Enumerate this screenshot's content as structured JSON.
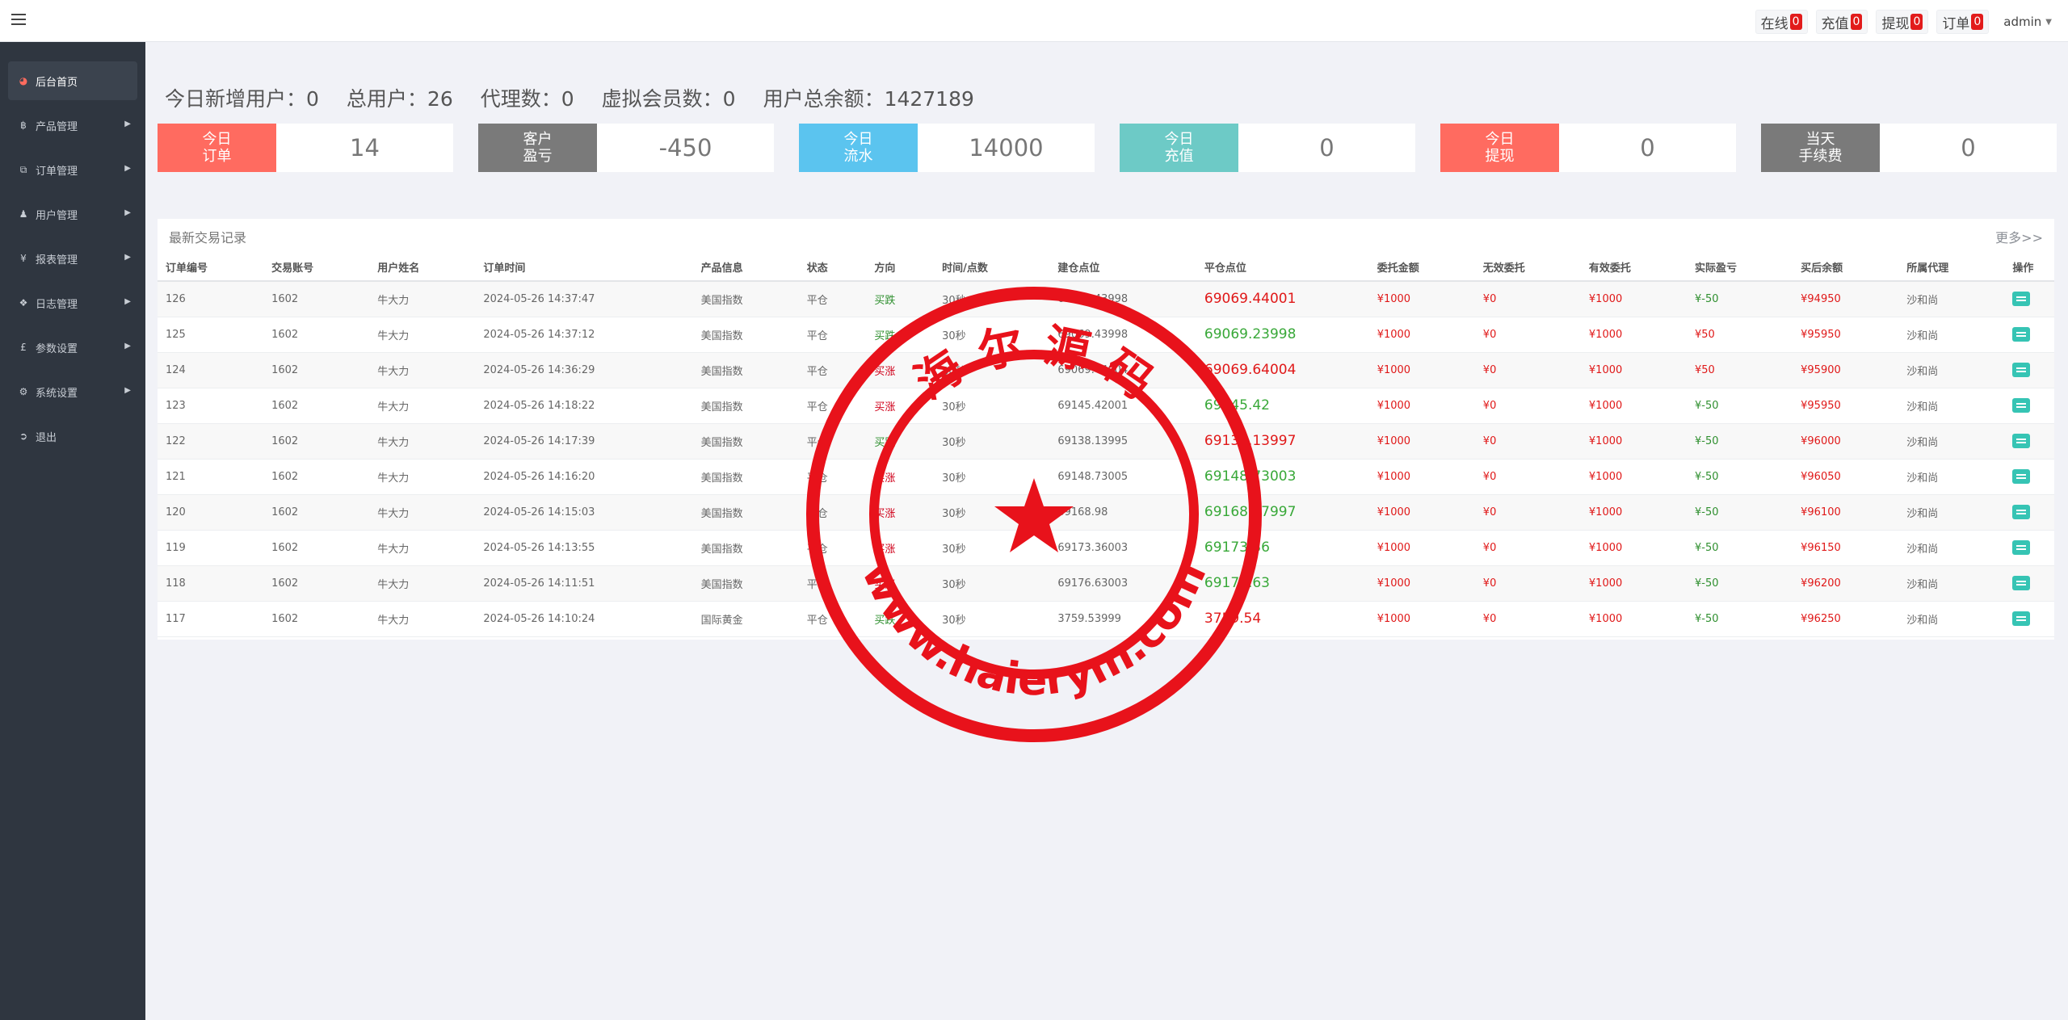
{
  "header": {
    "online_label": "在线",
    "online_count": "0",
    "recharge_label": "充值",
    "recharge_count": "0",
    "withdraw_label": "提现",
    "withdraw_count": "0",
    "order_label": "订单",
    "order_count": "0",
    "user_label": "admin"
  },
  "sidebar": {
    "items": [
      {
        "label": "后台首页",
        "icon": "dashboard-icon"
      },
      {
        "label": "产品管理",
        "icon": "bitcoin-icon"
      },
      {
        "label": "订单管理",
        "icon": "copy-icon"
      },
      {
        "label": "用户管理",
        "icon": "user-icon"
      },
      {
        "label": "报表管理",
        "icon": "yen-icon"
      },
      {
        "label": "日志管理",
        "icon": "tags-icon"
      },
      {
        "label": "参数设置",
        "icon": "pound-icon"
      },
      {
        "label": "系统设置",
        "icon": "gears-icon"
      },
      {
        "label": "退出",
        "icon": "sign-out-icon"
      }
    ]
  },
  "summary": {
    "new_users": "今日新增用户：0",
    "total_users": "总用户：26",
    "agents": "代理数：0",
    "virtual_members": "虚拟会员数：0",
    "total_balance": "用户总余额：1427189"
  },
  "cards": [
    {
      "label": "今日\n订单",
      "value": "14",
      "color": "#ff6b60"
    },
    {
      "label": "客户\n盈亏",
      "value": "-450",
      "color": "#7a7a7a"
    },
    {
      "label": "今日\n流水",
      "value": "14000",
      "color": "#5bc4ef"
    },
    {
      "label": "今日\n充值",
      "value": "0",
      "color": "#6dcac6"
    },
    {
      "label": "今日\n提现",
      "value": "0",
      "color": "#ff6b60"
    },
    {
      "label": "当天\n手续费",
      "value": "0",
      "color": "#7a7a7a"
    }
  ],
  "trades": {
    "title": "最新交易记录",
    "more": "更多>>",
    "columns": [
      "订单编号",
      "交易账号",
      "用户姓名",
      "订单时间",
      "产品信息",
      "状态",
      "方向",
      "时间/点数",
      "建仓点位",
      "平仓点位",
      "委托金额",
      "无效委托",
      "有效委托",
      "实际盈亏",
      "买后余额",
      "所属代理",
      "操作"
    ],
    "rows": [
      {
        "id": "126",
        "account": "1602",
        "name": "牛大力",
        "time": "2024-05-26 14:37:47",
        "product": "美国指数",
        "status": "平仓",
        "direction": "买跌",
        "duration": "30秒",
        "open": "69069.43998",
        "close": "69069.44001",
        "amount": "¥1000",
        "invalid": "¥0",
        "valid": "¥1000",
        "pnl": "¥-50",
        "balance": "¥94950",
        "agent": "沙和尚"
      },
      {
        "id": "125",
        "account": "1602",
        "name": "牛大力",
        "time": "2024-05-26 14:37:12",
        "product": "美国指数",
        "status": "平仓",
        "direction": "买跌",
        "duration": "30秒",
        "open": "69069.43998",
        "close": "69069.23998",
        "amount": "¥1000",
        "invalid": "¥0",
        "valid": "¥1000",
        "pnl": "¥50",
        "balance": "¥95950",
        "agent": "沙和尚"
      },
      {
        "id": "124",
        "account": "1602",
        "name": "牛大力",
        "time": "2024-05-26 14:36:29",
        "product": "美国指数",
        "status": "平仓",
        "direction": "买涨",
        "duration": "30秒",
        "open": "69069.44004",
        "close": "69069.64004",
        "amount": "¥1000",
        "invalid": "¥0",
        "valid": "¥1000",
        "pnl": "¥50",
        "balance": "¥95900",
        "agent": "沙和尚"
      },
      {
        "id": "123",
        "account": "1602",
        "name": "牛大力",
        "time": "2024-05-26 14:18:22",
        "product": "美国指数",
        "status": "平仓",
        "direction": "买涨",
        "duration": "30秒",
        "open": "69145.42001",
        "close": "69145.42",
        "amount": "¥1000",
        "invalid": "¥0",
        "valid": "¥1000",
        "pnl": "¥-50",
        "balance": "¥95950",
        "agent": "沙和尚"
      },
      {
        "id": "122",
        "account": "1602",
        "name": "牛大力",
        "time": "2024-05-26 14:17:39",
        "product": "美国指数",
        "status": "平仓",
        "direction": "买跌",
        "duration": "30秒",
        "open": "69138.13995",
        "close": "69138.13997",
        "amount": "¥1000",
        "invalid": "¥0",
        "valid": "¥1000",
        "pnl": "¥-50",
        "balance": "¥96000",
        "agent": "沙和尚"
      },
      {
        "id": "121",
        "account": "1602",
        "name": "牛大力",
        "time": "2024-05-26 14:16:20",
        "product": "美国指数",
        "status": "平仓",
        "direction": "买涨",
        "duration": "30秒",
        "open": "69148.73005",
        "close": "69148.73003",
        "amount": "¥1000",
        "invalid": "¥0",
        "valid": "¥1000",
        "pnl": "¥-50",
        "balance": "¥96050",
        "agent": "沙和尚"
      },
      {
        "id": "120",
        "account": "1602",
        "name": "牛大力",
        "time": "2024-05-26 14:15:03",
        "product": "美国指数",
        "status": "平仓",
        "direction": "买涨",
        "duration": "30秒",
        "open": "69168.98",
        "close": "69168.97997",
        "amount": "¥1000",
        "invalid": "¥0",
        "valid": "¥1000",
        "pnl": "¥-50",
        "balance": "¥96100",
        "agent": "沙和尚"
      },
      {
        "id": "119",
        "account": "1602",
        "name": "牛大力",
        "time": "2024-05-26 14:13:55",
        "product": "美国指数",
        "status": "平仓",
        "direction": "买涨",
        "duration": "30秒",
        "open": "69173.36003",
        "close": "69173.36",
        "amount": "¥1000",
        "invalid": "¥0",
        "valid": "¥1000",
        "pnl": "¥-50",
        "balance": "¥96150",
        "agent": "沙和尚"
      },
      {
        "id": "118",
        "account": "1602",
        "name": "牛大力",
        "time": "2024-05-26 14:11:51",
        "product": "美国指数",
        "status": "平仓",
        "direction": "买涨",
        "duration": "30秒",
        "open": "69176.63003",
        "close": "69176.63",
        "amount": "¥1000",
        "invalid": "¥0",
        "valid": "¥1000",
        "pnl": "¥-50",
        "balance": "¥96200",
        "agent": "沙和尚"
      },
      {
        "id": "117",
        "account": "1602",
        "name": "牛大力",
        "time": "2024-05-26 14:10:24",
        "product": "国际黄金",
        "status": "平仓",
        "direction": "买跌",
        "duration": "30秒",
        "open": "3759.53999",
        "close": "3759.54",
        "amount": "¥1000",
        "invalid": "¥0",
        "valid": "¥1000",
        "pnl": "¥-50",
        "balance": "¥96250",
        "agent": "沙和尚"
      }
    ]
  },
  "stamp": {
    "top_text": "海 尔 源 码",
    "bottom_text": "www.haierym.com",
    "color": "#e8121b"
  }
}
